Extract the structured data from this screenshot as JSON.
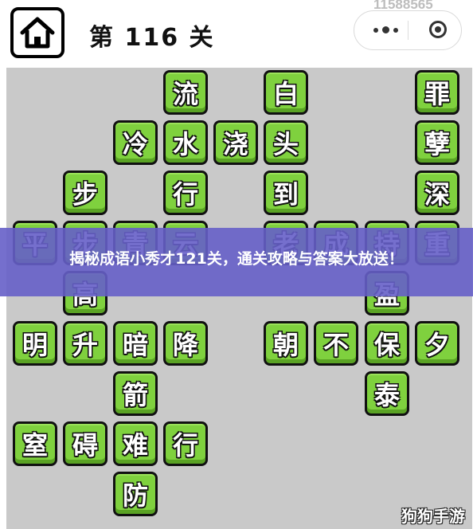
{
  "header": {
    "home_icon": "home-icon",
    "level_title": "第 116 关",
    "id_text": "11588565",
    "menu_icon": "more-dots-icon",
    "close_icon": "target-circle-icon"
  },
  "board": {
    "tiles": [
      {
        "char": "流"
      },
      {
        "char": "白"
      },
      {
        "char": "罪"
      },
      {
        "char": "冷"
      },
      {
        "char": "水"
      },
      {
        "char": "浇"
      },
      {
        "char": "头"
      },
      {
        "char": "孽"
      },
      {
        "char": "步"
      },
      {
        "char": "行"
      },
      {
        "char": "到"
      },
      {
        "char": "深"
      },
      {
        "char": "平"
      },
      {
        "char": "步"
      },
      {
        "char": "青"
      },
      {
        "char": "云"
      },
      {
        "char": "老"
      },
      {
        "char": "成"
      },
      {
        "char": "持"
      },
      {
        "char": "重"
      },
      {
        "char": "高"
      },
      {
        "char": "盈"
      },
      {
        "char": "明"
      },
      {
        "char": "升"
      },
      {
        "char": "暗"
      },
      {
        "char": "降"
      },
      {
        "char": "朝"
      },
      {
        "char": "不"
      },
      {
        "char": "保"
      },
      {
        "char": "夕"
      },
      {
        "char": "箭"
      },
      {
        "char": "泰"
      },
      {
        "char": "窒"
      },
      {
        "char": "碍"
      },
      {
        "char": "难"
      },
      {
        "char": "行"
      },
      {
        "char": "防"
      }
    ]
  },
  "banner": {
    "text": "揭秘成语小秀才121关，通关攻略与答案大放送！"
  },
  "watermark": "狗狗手游"
}
